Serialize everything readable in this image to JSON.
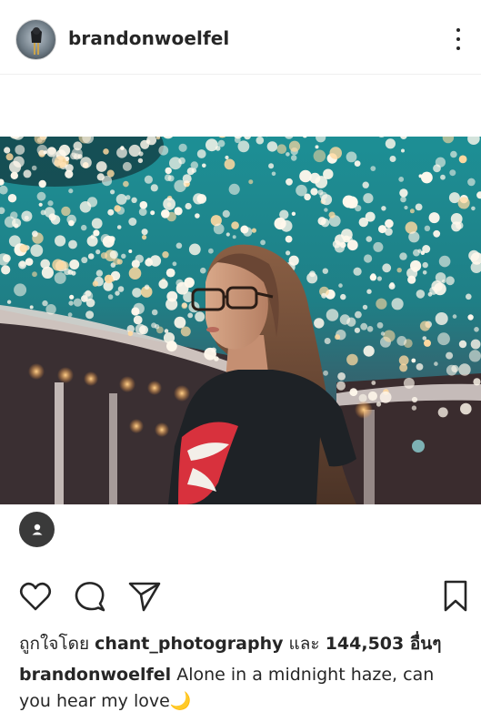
{
  "post": {
    "author": "brandonwoelfel",
    "avatar_icon": "profile-photo-avatar",
    "more_icon": "more-options-icon",
    "image_alt_icon": "photo-bokeh-portrait"
  },
  "actions": {
    "like_icon": "heart-icon",
    "comment_icon": "comment-icon",
    "share_icon": "send-icon",
    "save_icon": "bookmark-icon",
    "tag_icon": "user-tag-icon"
  },
  "likes": {
    "prefix": "ถูกใจโดย",
    "first_liker": "chant_photography",
    "conjunction": "และ",
    "count_text": "144,503 อื่นๆ"
  },
  "caption": {
    "username": "brandonwoelfel",
    "text": "Alone in a midnight haze, can you hear my love🌙"
  },
  "colors": {
    "text": "#262626",
    "divider": "#efefef",
    "tag_button": "#3a3a3a"
  }
}
